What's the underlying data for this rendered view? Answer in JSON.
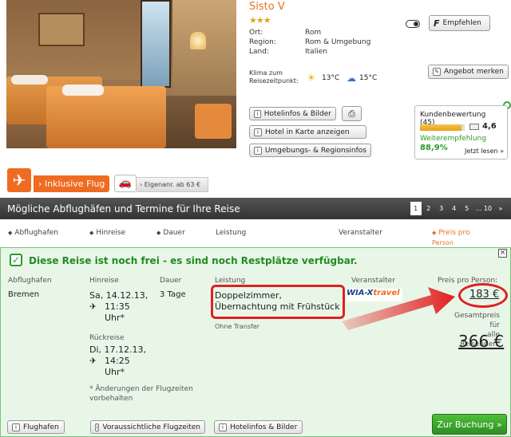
{
  "hotel": {
    "name": "Sisto V",
    "stars": "★★★",
    "ort_label": "Ort:",
    "ort": "Rom",
    "region_label": "Region:",
    "region": "Rom & Umgebung",
    "land_label": "Land:",
    "land": "Italien",
    "klima_label_1": "Klima zum",
    "klima_label_2": "Reisezeitpunkt:",
    "temp_sun": "13°C",
    "temp_cloud": "15°C"
  },
  "actions": {
    "empfehlen": "Empfehlen",
    "angebot_merken": "Angebot merken",
    "hotelinfos": "Hotelinfos & Bilder",
    "hotel_karte": "Hotel in Karte anzeigen",
    "umgebung": "Umgebungs- & Regionsinfos"
  },
  "rating": {
    "label": "Kundenbewertung (45)",
    "score": "4,6",
    "score_fraction": 0.92,
    "recommend_label": "Weiterempfehlung",
    "recommend_pct": "88,9%",
    "more": "Jetzt lesen »"
  },
  "tabs": {
    "inclusive": "› Inklusive Flug",
    "self": "› Eigenanr. ab 63 €"
  },
  "header": {
    "title": "Mögliche Abflughäfen und Termine für Ihre Reise",
    "pages": [
      "1",
      "2",
      "3",
      "4",
      "5",
      "... 10",
      "»"
    ]
  },
  "columns": {
    "abflughafen": "Abflughafen",
    "hinreise": "Hinreise",
    "dauer": "Dauer",
    "leistung": "Leistung",
    "veranstalter": "Veranstalter",
    "preis": "Preis pro",
    "preis2": "Person"
  },
  "offer": {
    "availability": "Diese Reise ist noch frei - es sind noch Restplätze verfügbar.",
    "abflughafen_label": "Abflughafen",
    "abflughafen": "Bremen",
    "hinreise_label": "Hinreise",
    "hin_date": "Sa, 14.12.13,",
    "hin_time": "11:35",
    "hin_uhr": "Uhr*",
    "rueck_label": "Rückreise",
    "rueck_date": "Di, 17.12.13,",
    "rueck_time": "14:25",
    "rueck_uhr": "Uhr*",
    "note": "* Änderungen der Flugzeiten vorbehalten",
    "dauer_label": "Dauer",
    "dauer": "3 Tage",
    "leistung_label": "Leistung",
    "leistung_1": "Doppelzimmer,",
    "leistung_2": "Übernachtung mit Frühstück",
    "transfer": "Ohne Transfer",
    "veranstalter_label": "Veranstalter",
    "logo_a": "WIA-X",
    "logo_b": "travel",
    "preis_label": "Preis pro Person:",
    "preis": "183 €",
    "gesamt_label_1": "Gesamtpreis für",
    "gesamt_label_2": "alle Reisenden:",
    "gesamt": "366 €"
  },
  "bottom": {
    "flughafen": "Flughafen",
    "flugzeiten": "Voraussichtliche Flugzeiten",
    "hotelinfos": "Hotelinfos & Bilder",
    "buchung": "Zur Buchung »"
  },
  "colors": {
    "accent_orange": "#ef6b22",
    "green": "#2e8e22",
    "highlight_red": "#e02020"
  }
}
